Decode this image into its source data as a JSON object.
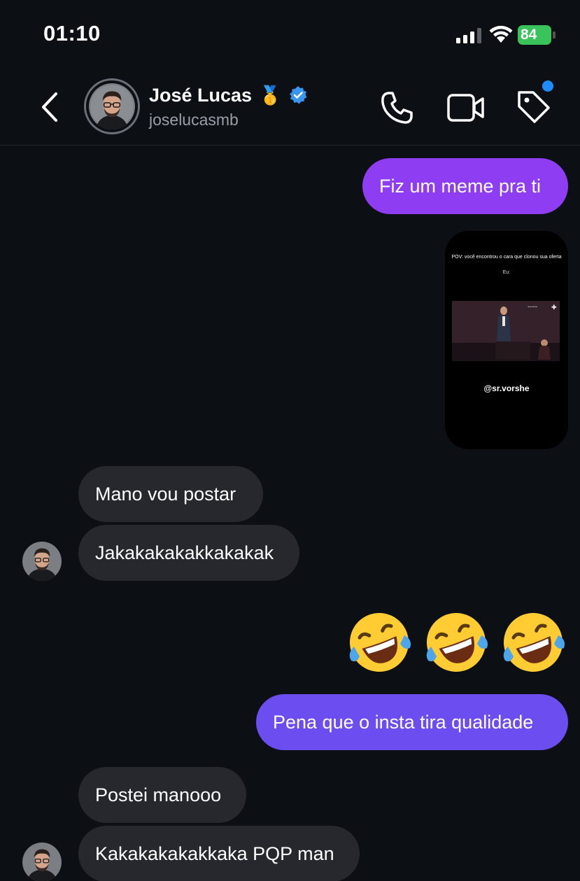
{
  "status_bar": {
    "time": "01:10",
    "battery_percent": "84",
    "battery_color": "#3ac35b"
  },
  "header": {
    "contact_name": "José Lucas",
    "medal": "🥇",
    "handle": "joselucasmb",
    "verified_color": "#3797f0",
    "notification_dot_color": "#1e8cff"
  },
  "messages": {
    "m1": "Fiz um meme pra ti",
    "media": {
      "caption": "POV: você encontrou o cara que clonou sua oferta",
      "eu": "Eu:",
      "credit": "@sr.vorshe"
    },
    "m2": "Mano vou postar",
    "m3": "Jakakakakakkakakak",
    "emojis": "🤣🤣🤣",
    "m4": "Pena que o insta tira qualidade",
    "m5": "Postei manooo",
    "m6": "Kakakakakakkaka PQP man"
  },
  "colors": {
    "background": "#0c0f14",
    "sent_bubble": "#8e3df3",
    "sent_bubble_alt": "#6b4df0",
    "received_bubble": "#26282e"
  }
}
